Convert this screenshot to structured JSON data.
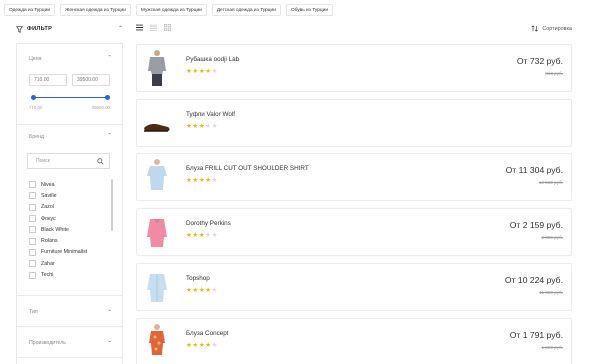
{
  "tags": [
    "Одежда из Турции",
    "Женская одежда из Турции",
    "Мужская одежда из Турции",
    "Детская одежда из Турции",
    "Обувь из Турции"
  ],
  "filter": {
    "title": "ФИЛЬТР",
    "price": {
      "title": "Цена",
      "min_value": "710.00",
      "max_value": "39500.00",
      "min_label": "710.00",
      "max_label": "39500.00"
    },
    "brand": {
      "title": "Бренд",
      "search_placeholder": "Поиск",
      "items": [
        "Nivea",
        "Saville",
        "Zazol",
        "Фокус",
        "Black White",
        "Rolans",
        "Furniture Minimalist",
        "Zahar",
        "Techi"
      ]
    },
    "type": {
      "title": "Тип"
    },
    "manufacturer": {
      "title": "Производитель"
    }
  },
  "toolbar": {
    "views": [
      "list-view-icon",
      "compact-list-icon",
      "grid-view-icon"
    ],
    "sort_label": "Сортировка"
  },
  "products": [
    {
      "name": "Рубашка oodji Lab",
      "rating": 4,
      "price": "От  732 руб.",
      "old_price": "810 руб."
    },
    {
      "name": "Туфли Valor Wolf",
      "rating": 3,
      "price": "",
      "old_price": ""
    },
    {
      "name": "Блуза FRILL CUT OUT SHOULDER SHIRT",
      "rating": 4,
      "price": "От  11 304 руб.",
      "old_price": "12 560 руб."
    },
    {
      "name": "Dorothy Perkins",
      "rating": 3,
      "price": "От  2 159 руб.",
      "old_price": "2 399 руб."
    },
    {
      "name": "Topshop",
      "rating": 4,
      "price": "От  10 224 руб.",
      "old_price": "11 360 руб."
    },
    {
      "name": "Блуза Concept",
      "rating": 4,
      "price": "От  1 791 руб.",
      "old_price": "1 990 руб."
    }
  ],
  "colors": {
    "accent": "#2962d9",
    "star": "#f5b301"
  }
}
